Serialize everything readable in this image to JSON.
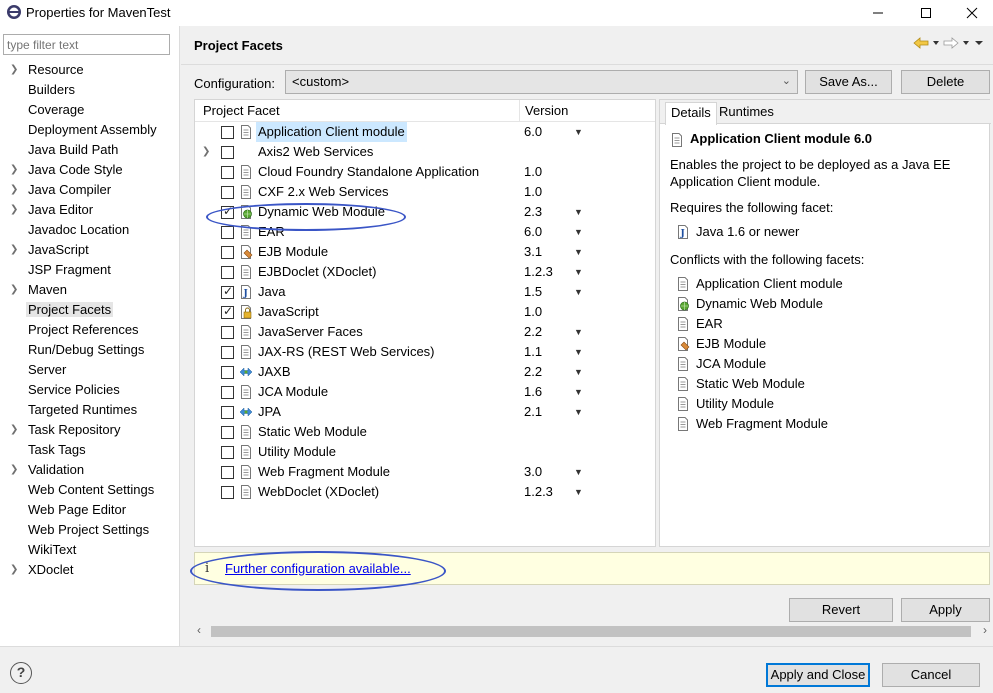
{
  "window": {
    "title": "Properties for MavenTest"
  },
  "filter": {
    "placeholder": "type filter text"
  },
  "nav": {
    "items": [
      {
        "label": "Resource",
        "expandable": true
      },
      {
        "label": "Builders",
        "expandable": false
      },
      {
        "label": "Coverage",
        "expandable": false
      },
      {
        "label": "Deployment Assembly",
        "expandable": false
      },
      {
        "label": "Java Build Path",
        "expandable": false
      },
      {
        "label": "Java Code Style",
        "expandable": true
      },
      {
        "label": "Java Compiler",
        "expandable": true
      },
      {
        "label": "Java Editor",
        "expandable": true
      },
      {
        "label": "Javadoc Location",
        "expandable": false
      },
      {
        "label": "JavaScript",
        "expandable": true
      },
      {
        "label": "JSP Fragment",
        "expandable": false
      },
      {
        "label": "Maven",
        "expandable": true
      },
      {
        "label": "Project Facets",
        "expandable": false,
        "selected": true
      },
      {
        "label": "Project References",
        "expandable": false
      },
      {
        "label": "Run/Debug Settings",
        "expandable": false
      },
      {
        "label": "Server",
        "expandable": false
      },
      {
        "label": "Service Policies",
        "expandable": false
      },
      {
        "label": "Targeted Runtimes",
        "expandable": false
      },
      {
        "label": "Task Repository",
        "expandable": true
      },
      {
        "label": "Task Tags",
        "expandable": false
      },
      {
        "label": "Validation",
        "expandable": true
      },
      {
        "label": "Web Content Settings",
        "expandable": false
      },
      {
        "label": "Web Page Editor",
        "expandable": false
      },
      {
        "label": "Web Project Settings",
        "expandable": false
      },
      {
        "label": "WikiText",
        "expandable": false
      },
      {
        "label": "XDoclet",
        "expandable": true
      }
    ]
  },
  "page": {
    "title": "Project Facets"
  },
  "config": {
    "label": "Configuration:",
    "value": "<custom>",
    "save_as": "Save As...",
    "delete": "Delete"
  },
  "facets": {
    "col_facet": "Project Facet",
    "col_version": "Version",
    "rows": [
      {
        "name": "Application Client module",
        "version": "6.0",
        "dropdown": true,
        "checked": false,
        "icon": "page",
        "selected": true
      },
      {
        "name": "Axis2 Web Services",
        "version": "",
        "dropdown": false,
        "checked": false,
        "icon": "none",
        "expandable": true
      },
      {
        "name": "Cloud Foundry Standalone Application",
        "version": "1.0",
        "dropdown": false,
        "checked": false,
        "icon": "page"
      },
      {
        "name": "CXF 2.x Web Services",
        "version": "1.0",
        "dropdown": false,
        "checked": false,
        "icon": "page"
      },
      {
        "name": "Dynamic Web Module",
        "version": "2.3",
        "dropdown": true,
        "checked": true,
        "icon": "web"
      },
      {
        "name": "EAR",
        "version": "6.0",
        "dropdown": true,
        "checked": false,
        "icon": "page"
      },
      {
        "name": "EJB Module",
        "version": "3.1",
        "dropdown": true,
        "checked": false,
        "icon": "ejb"
      },
      {
        "name": "EJBDoclet (XDoclet)",
        "version": "1.2.3",
        "dropdown": true,
        "checked": false,
        "icon": "page"
      },
      {
        "name": "Java",
        "version": "1.5",
        "dropdown": true,
        "checked": true,
        "icon": "java"
      },
      {
        "name": "JavaScript",
        "version": "1.0",
        "dropdown": false,
        "checked": true,
        "icon": "lock"
      },
      {
        "name": "JavaServer Faces",
        "version": "2.2",
        "dropdown": true,
        "checked": false,
        "icon": "page"
      },
      {
        "name": "JAX-RS (REST Web Services)",
        "version": "1.1",
        "dropdown": true,
        "checked": false,
        "icon": "page"
      },
      {
        "name": "JAXB",
        "version": "2.2",
        "dropdown": true,
        "checked": false,
        "icon": "jaxb"
      },
      {
        "name": "JCA Module",
        "version": "1.6",
        "dropdown": true,
        "checked": false,
        "icon": "page"
      },
      {
        "name": "JPA",
        "version": "2.1",
        "dropdown": true,
        "checked": false,
        "icon": "jaxb"
      },
      {
        "name": "Static Web Module",
        "version": "",
        "dropdown": false,
        "checked": false,
        "icon": "page"
      },
      {
        "name": "Utility Module",
        "version": "",
        "dropdown": false,
        "checked": false,
        "icon": "page"
      },
      {
        "name": "Web Fragment Module",
        "version": "3.0",
        "dropdown": true,
        "checked": false,
        "icon": "page"
      },
      {
        "name": "WebDoclet (XDoclet)",
        "version": "1.2.3",
        "dropdown": true,
        "checked": false,
        "icon": "page"
      }
    ]
  },
  "details": {
    "tab_details": "Details",
    "tab_runtimes": "Runtimes",
    "title": "Application Client module 6.0",
    "description": "Enables the project to be deployed as a Java EE Application Client module.",
    "requires_label": "Requires the following facet:",
    "requires": [
      {
        "name": "Java 1.6 or newer",
        "icon": "java"
      }
    ],
    "conflicts_label": "Conflicts with the following facets:",
    "conflicts": [
      {
        "name": "Application Client module",
        "icon": "page"
      },
      {
        "name": "Dynamic Web Module",
        "icon": "web"
      },
      {
        "name": "EAR",
        "icon": "page"
      },
      {
        "name": "EJB Module",
        "icon": "ejb"
      },
      {
        "name": "JCA Module",
        "icon": "page"
      },
      {
        "name": "Static Web Module",
        "icon": "page"
      },
      {
        "name": "Utility Module",
        "icon": "page"
      },
      {
        "name": "Web Fragment Module",
        "icon": "page"
      }
    ]
  },
  "info": {
    "icon": "info-icon",
    "link": "Further configuration available..."
  },
  "buttons": {
    "revert": "Revert",
    "apply": "Apply",
    "apply_close": "Apply and Close",
    "cancel": "Cancel",
    "help": "?"
  },
  "colors": {
    "accent": "#0078d7",
    "annotation": "#3a55c6",
    "selection": "#cce8ff",
    "info_bg": "#ffffe1"
  }
}
